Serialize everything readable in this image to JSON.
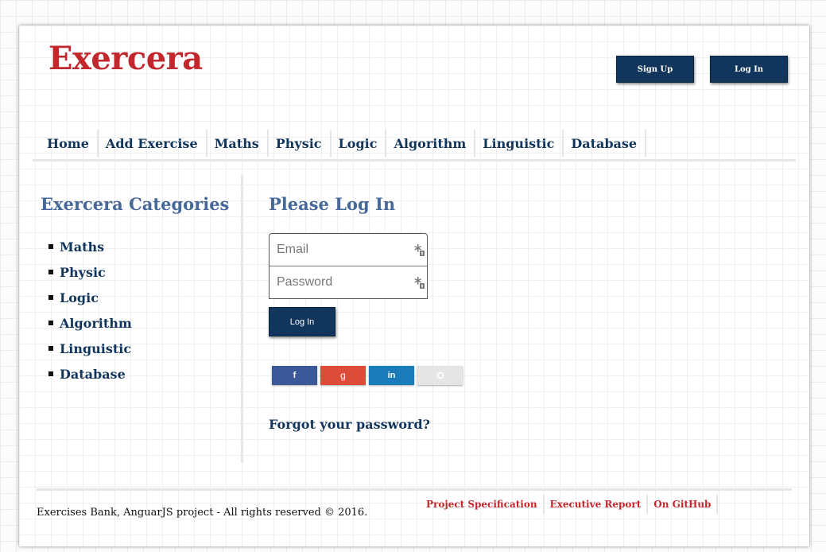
{
  "header": {
    "logo": "Exercera",
    "signup_label": "Sign Up",
    "login_label": "Log In"
  },
  "nav": {
    "items": [
      "Home",
      "Add Exercise",
      "Maths",
      "Physic",
      "Logic",
      "Algorithm",
      "Linguistic",
      "Database"
    ]
  },
  "sidebar": {
    "title": "Exercera Categories",
    "categories": [
      "Maths",
      "Physic",
      "Logic",
      "Algorithm",
      "Linguistic",
      "Database"
    ]
  },
  "login_form": {
    "title": "Please Log In",
    "email_placeholder": "Email",
    "password_placeholder": "Password",
    "submit_label": "Log In",
    "social": [
      {
        "icon": "facebook-icon",
        "glyph": "f",
        "color": "#3b5998"
      },
      {
        "icon": "google-plus-icon",
        "glyph": "g",
        "color": "#dd4b39"
      },
      {
        "icon": "linkedin-icon",
        "glyph": "in",
        "color": "#1a7bba"
      },
      {
        "icon": "github-icon",
        "glyph": "",
        "color": "#e5e5e5"
      }
    ],
    "forgot_label": "Forgot your password?"
  },
  "footer": {
    "copyright": "Exercises Bank, AnguarJS project - All rights reserved © 2016.",
    "links": [
      "Project Specification",
      "Executive Report",
      "On GitHub"
    ]
  },
  "colors": {
    "brand_red": "#c1272d",
    "navy": "#12355b",
    "heading_blue": "#46699a"
  }
}
